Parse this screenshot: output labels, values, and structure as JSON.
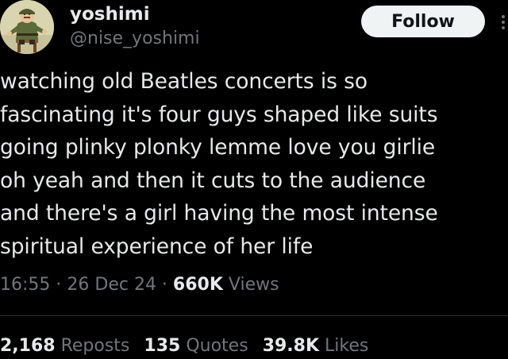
{
  "author": {
    "display_name": "yoshimi",
    "handle": "@nise_yoshimi"
  },
  "follow_button": {
    "label": "Follow"
  },
  "tweet": {
    "text": "watching old Beatles concerts is so\nfascinating it's four guys shaped like suits\ngoing plinky plonky lemme love you girlie\noh yeah and then it cuts to the audience\nand there's a girl having the most intense\nspiritual experience of her life"
  },
  "meta": {
    "time": "16:55",
    "separator": " · ",
    "date": "26 Dec 24",
    "views_count": "660K",
    "views_label": " Views"
  },
  "stats": {
    "reposts_count": "2,168",
    "reposts_label": " Reposts",
    "quotes_count": "135",
    "quotes_label": " Quotes",
    "likes_count": "39.8K",
    "likes_label": " Likes"
  },
  "icons": {
    "avatar": "profile-picture",
    "more": "more-options-icon"
  },
  "colors": {
    "background": "#000000",
    "primary_text": "#e7e9ea",
    "secondary_text": "#71767b",
    "follow_button_bg": "#eff3f4",
    "follow_button_text": "#0f1419",
    "divider": "#2f3336"
  }
}
